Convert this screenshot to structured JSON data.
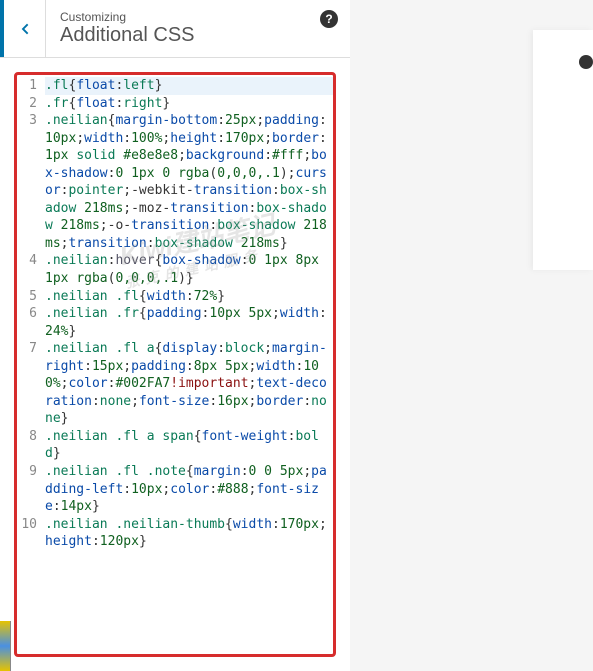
{
  "header": {
    "breadcrumb": "Customizing",
    "title": "Additional CSS",
    "help_symbol": "?"
  },
  "watermark": {
    "line1": "Kiwi建站笔记",
    "line2": "张克的建站服务"
  },
  "code_lines": [
    {
      "n": "1",
      "active": true,
      "tokens": [
        [
          ".fl",
          "sel"
        ],
        [
          "{",
          "punct"
        ],
        [
          "float",
          "prop"
        ],
        [
          ":",
          "punct"
        ],
        [
          "left",
          "val"
        ],
        [
          "}",
          "punct"
        ]
      ]
    },
    {
      "n": "2",
      "tokens": [
        [
          ".fr",
          "sel"
        ],
        [
          "{",
          "punct"
        ],
        [
          "float",
          "prop"
        ],
        [
          ":",
          "punct"
        ],
        [
          "right",
          "val"
        ],
        [
          "}",
          "punct"
        ]
      ]
    },
    {
      "n": "3",
      "tokens": [
        [
          ".neilian",
          "sel"
        ],
        [
          "{",
          "punct"
        ],
        [
          "margin-bottom",
          "prop"
        ],
        [
          ":",
          "punct"
        ],
        [
          "25px",
          "num"
        ],
        [
          ";",
          "punct"
        ],
        [
          "padding",
          "prop"
        ],
        [
          ":",
          "punct"
        ],
        [
          "10px",
          "num"
        ],
        [
          ";",
          "punct"
        ],
        [
          "width",
          "prop"
        ],
        [
          ":",
          "punct"
        ],
        [
          "100%",
          "num"
        ],
        [
          ";",
          "punct"
        ],
        [
          "height",
          "prop"
        ],
        [
          ":",
          "punct"
        ],
        [
          "170px",
          "num"
        ],
        [
          ";",
          "punct"
        ],
        [
          "border",
          "prop"
        ],
        [
          ":",
          "punct"
        ],
        [
          "1px ",
          "num"
        ],
        [
          "solid ",
          "val"
        ],
        [
          "#e8e8e8",
          "num"
        ],
        [
          ";",
          "punct"
        ],
        [
          "background",
          "prop"
        ],
        [
          ":",
          "punct"
        ],
        [
          "#fff",
          "num"
        ],
        [
          ";",
          "punct"
        ],
        [
          "box-shadow",
          "prop"
        ],
        [
          ":",
          "punct"
        ],
        [
          "0 1px 0 ",
          "num"
        ],
        [
          "rgba",
          "fn"
        ],
        [
          "(",
          "punct"
        ],
        [
          "0,0,0,.1",
          "num"
        ],
        [
          ")",
          "punct"
        ],
        [
          ";",
          "punct"
        ],
        [
          "cursor",
          "prop"
        ],
        [
          ":",
          "punct"
        ],
        [
          "pointer",
          "val"
        ],
        [
          ";",
          "punct"
        ],
        [
          "-webkit-",
          "punct"
        ],
        [
          "transition",
          "prop"
        ],
        [
          ":",
          "punct"
        ],
        [
          "box-shadow ",
          "val"
        ],
        [
          "218ms",
          "num"
        ],
        [
          ";",
          "punct"
        ],
        [
          "-moz-",
          "punct"
        ],
        [
          "transition",
          "prop"
        ],
        [
          ":",
          "punct"
        ],
        [
          "box-shadow ",
          "val"
        ],
        [
          "218ms",
          "num"
        ],
        [
          ";",
          "punct"
        ],
        [
          "-o-",
          "punct"
        ],
        [
          "transition",
          "prop"
        ],
        [
          ":",
          "punct"
        ],
        [
          "box-shadow ",
          "val"
        ],
        [
          "218ms",
          "num"
        ],
        [
          ";",
          "punct"
        ],
        [
          "transition",
          "prop"
        ],
        [
          ":",
          "punct"
        ],
        [
          "box-shadow ",
          "val"
        ],
        [
          "218ms",
          "num"
        ],
        [
          "}",
          "punct"
        ]
      ]
    },
    {
      "n": "4",
      "tokens": [
        [
          ".neilian",
          "sel"
        ],
        [
          ":",
          "punct"
        ],
        [
          "hover",
          "kw"
        ],
        [
          "{",
          "punct"
        ],
        [
          "box-shadow",
          "prop"
        ],
        [
          ":",
          "punct"
        ],
        [
          "0 1px 8px 1px ",
          "num"
        ],
        [
          "rgba",
          "fn"
        ],
        [
          "(",
          "punct"
        ],
        [
          "0,0,0,.1",
          "num"
        ],
        [
          ")",
          "punct"
        ],
        [
          "}",
          "punct"
        ]
      ]
    },
    {
      "n": "5",
      "tokens": [
        [
          ".neilian .fl",
          "sel"
        ],
        [
          "{",
          "punct"
        ],
        [
          "width",
          "prop"
        ],
        [
          ":",
          "punct"
        ],
        [
          "72%",
          "num"
        ],
        [
          "}",
          "punct"
        ]
      ]
    },
    {
      "n": "6",
      "tokens": [
        [
          ".neilian .fr",
          "sel"
        ],
        [
          "{",
          "punct"
        ],
        [
          "padding",
          "prop"
        ],
        [
          ":",
          "punct"
        ],
        [
          "10px 5px",
          "num"
        ],
        [
          ";",
          "punct"
        ],
        [
          "width",
          "prop"
        ],
        [
          ":",
          "punct"
        ],
        [
          "24%",
          "num"
        ],
        [
          "}",
          "punct"
        ]
      ]
    },
    {
      "n": "7",
      "tokens": [
        [
          ".neilian .fl a",
          "sel"
        ],
        [
          "{",
          "punct"
        ],
        [
          "display",
          "prop"
        ],
        [
          ":",
          "punct"
        ],
        [
          "block",
          "val"
        ],
        [
          ";",
          "punct"
        ],
        [
          "margin-right",
          "prop"
        ],
        [
          ":",
          "punct"
        ],
        [
          "15px",
          "num"
        ],
        [
          ";",
          "punct"
        ],
        [
          "padding",
          "prop"
        ],
        [
          ":",
          "punct"
        ],
        [
          "8px 5px",
          "num"
        ],
        [
          ";",
          "punct"
        ],
        [
          "width",
          "prop"
        ],
        [
          ":",
          "punct"
        ],
        [
          "100%",
          "num"
        ],
        [
          ";",
          "punct"
        ],
        [
          "color",
          "prop"
        ],
        [
          ":",
          "punct"
        ],
        [
          "#002FA7",
          "num"
        ],
        [
          "!important",
          "imp"
        ],
        [
          ";",
          "punct"
        ],
        [
          "text-decoration",
          "prop"
        ],
        [
          ":",
          "punct"
        ],
        [
          "none",
          "val"
        ],
        [
          ";",
          "punct"
        ],
        [
          "font-size",
          "prop"
        ],
        [
          ":",
          "punct"
        ],
        [
          "16px",
          "num"
        ],
        [
          ";",
          "punct"
        ],
        [
          "border",
          "prop"
        ],
        [
          ":",
          "punct"
        ],
        [
          "none",
          "val"
        ],
        [
          "}",
          "punct"
        ]
      ]
    },
    {
      "n": "8",
      "tokens": [
        [
          ".neilian .fl a span",
          "sel"
        ],
        [
          "{",
          "punct"
        ],
        [
          "font-weight",
          "prop"
        ],
        [
          ":",
          "punct"
        ],
        [
          "bold",
          "val"
        ],
        [
          "}",
          "punct"
        ]
      ]
    },
    {
      "n": "9",
      "tokens": [
        [
          ".neilian .fl .note",
          "sel"
        ],
        [
          "{",
          "punct"
        ],
        [
          "margin",
          "prop"
        ],
        [
          ":",
          "punct"
        ],
        [
          "0 0 5px",
          "num"
        ],
        [
          ";",
          "punct"
        ],
        [
          "padding-left",
          "prop"
        ],
        [
          ":",
          "punct"
        ],
        [
          "10px",
          "num"
        ],
        [
          ";",
          "punct"
        ],
        [
          "color",
          "prop"
        ],
        [
          ":",
          "punct"
        ],
        [
          "#888",
          "num"
        ],
        [
          ";",
          "punct"
        ],
        [
          "font-size",
          "prop"
        ],
        [
          ":",
          "punct"
        ],
        [
          "14px",
          "num"
        ],
        [
          "}",
          "punct"
        ]
      ]
    },
    {
      "n": "10",
      "tokens": [
        [
          ".neilian .neilian-thumb",
          "sel"
        ],
        [
          "{",
          "punct"
        ],
        [
          "width",
          "prop"
        ],
        [
          ":",
          "punct"
        ],
        [
          "170px",
          "num"
        ],
        [
          ";",
          "punct"
        ],
        [
          "height",
          "prop"
        ],
        [
          ":",
          "punct"
        ],
        [
          "120px",
          "num"
        ],
        [
          "}",
          "punct"
        ]
      ]
    }
  ]
}
